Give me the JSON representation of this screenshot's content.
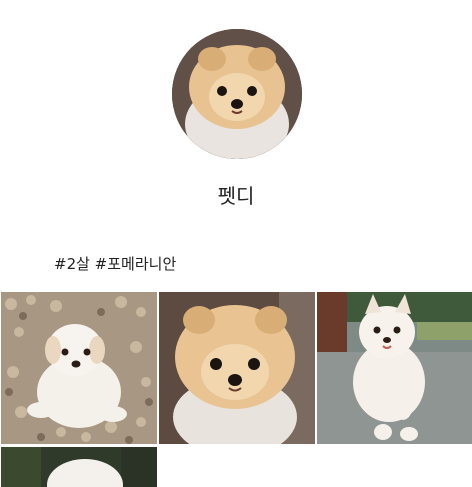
{
  "profile": {
    "name": "펫디",
    "tags": "#2살 #포메라니안"
  },
  "photos": [
    {
      "icon": "puppy-on-gravel-photo"
    },
    {
      "icon": "pomeranian-closeup-photo"
    },
    {
      "icon": "white-puppy-running-photo"
    },
    {
      "icon": "white-puppy-partial-photo"
    }
  ],
  "colors": {
    "background": "#ffffff",
    "text": "#222222"
  }
}
